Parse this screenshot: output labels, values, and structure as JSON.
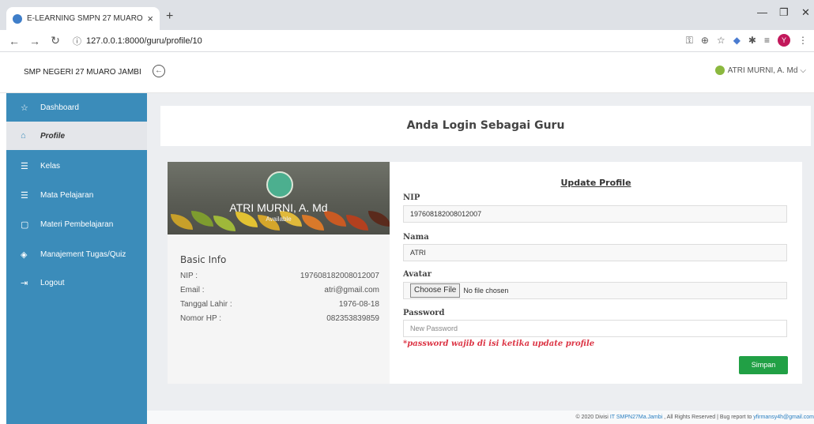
{
  "browser": {
    "tab_title": "E-LEARNING SMPN 27 MUARO JAMBI",
    "url_info": "ⓘ",
    "url": "127.0.0.1:8000/guru/profile/10",
    "profile_initial": "Y"
  },
  "header": {
    "brand": "SMP NEGERI 27 MUARO JAMBI",
    "user_name": "ATRI MURNI, A. Md"
  },
  "sidebar": {
    "items": [
      {
        "label": "Dashboard",
        "icon": "star-icon"
      },
      {
        "label": "Profile",
        "icon": "home-icon"
      },
      {
        "label": "Kelas",
        "icon": "database-icon"
      },
      {
        "label": "Mata Pelajaran",
        "icon": "database-icon"
      },
      {
        "label": "Materi Pembelajaran",
        "icon": "square-icon"
      },
      {
        "label": "Manajement Tugas/Quiz",
        "icon": "layers-icon"
      },
      {
        "label": "Logout",
        "icon": "logout-icon"
      }
    ]
  },
  "main": {
    "banner": "Anda Login Sebagai Guru",
    "profile_card": {
      "name": "ATRI MURNI, A. Md",
      "status": "Available",
      "basic_info_title": "Basic Info",
      "rows": [
        {
          "label": "NIP :",
          "value": "197608182008012007"
        },
        {
          "label": "Email :",
          "value": "atri@gmail.com"
        },
        {
          "label": "Tanggal Lahir :",
          "value": "1976-08-18"
        },
        {
          "label": "Nomor HP :",
          "value": "082353839859"
        }
      ]
    },
    "form": {
      "title": "Update Profile",
      "nip_label": "NIP",
      "nip_value": "197608182008012007",
      "nama_label": "Nama",
      "nama_value": "ATRI",
      "avatar_label": "Avatar",
      "choose_file": "Choose File",
      "no_file": "No file chosen",
      "password_label": "Password",
      "password_placeholder": "New Password",
      "password_note": "*password wajib di isi ketika update profile",
      "save_label": "Simpan"
    }
  },
  "footer": {
    "prefix": "© 2020 Divisi ",
    "link1": "IT SMPN27Ma.Jambi",
    "middle": " , All Rights Reserved | Bug report to ",
    "link2": "yfirmansy4h@gmail.com"
  }
}
